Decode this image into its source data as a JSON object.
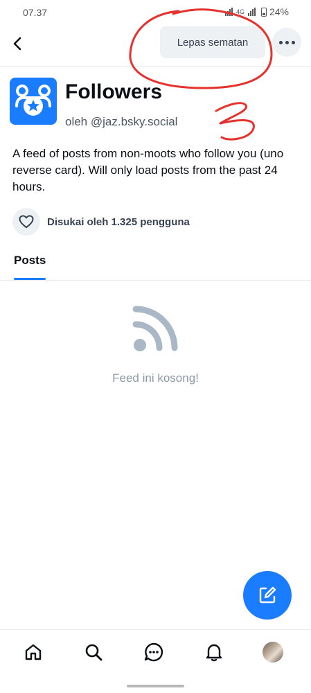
{
  "status_bar": {
    "time": "07.37",
    "network": "4G",
    "battery": "24%"
  },
  "topbar": {
    "unpin_label": "Lepas sematan"
  },
  "feed": {
    "title": "Followers",
    "author": "oleh @jaz.bsky.social",
    "description": "A feed of posts from non-moots who follow you (uno reverse card). Will only load posts from the past 24 hours.",
    "likes_text": "Disukai oleh 1.325 pengguna"
  },
  "tabs": [
    {
      "label": "Posts",
      "active": true
    }
  ],
  "empty_state": {
    "message": "Feed ini kosong!"
  },
  "colors": {
    "accent": "#1a7cff",
    "annotation": "#e5322d"
  }
}
